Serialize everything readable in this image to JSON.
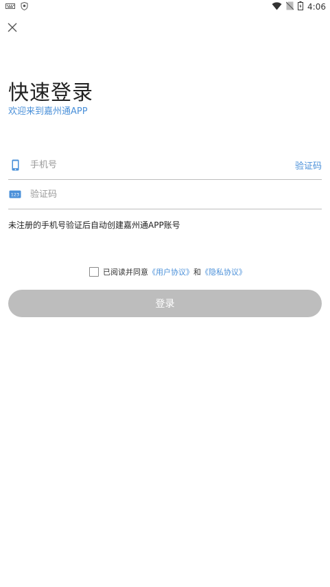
{
  "status_bar": {
    "time": "4:06",
    "icons": [
      "keyboard-icon",
      "shield-icon",
      "wifi-icon",
      "no-sim-icon",
      "battery-icon"
    ]
  },
  "header": {
    "close_icon": "close-icon"
  },
  "main": {
    "title": "快速登录",
    "subtitle": "欢迎来到嘉州通APP",
    "phone_field": {
      "placeholder": "手机号",
      "value": "",
      "icon": "phone-icon",
      "get_code_label": "验证码"
    },
    "code_field": {
      "placeholder": "验证码",
      "value": "",
      "icon": "number-pad-icon"
    },
    "hint": "未注册的手机号验证后自动创建嘉州通APP账号",
    "agreement": {
      "prefix": "已阅读并同意",
      "user_agreement": "《用户协议》",
      "and": "和",
      "privacy_agreement": "《隐私协议》"
    },
    "login_label": "登录"
  },
  "colors": {
    "accent": "#4a90d9",
    "button_disabled": "#bdbdbd",
    "divider": "#bdbdbd",
    "text_primary": "#222222",
    "text_placeholder": "#999999"
  }
}
